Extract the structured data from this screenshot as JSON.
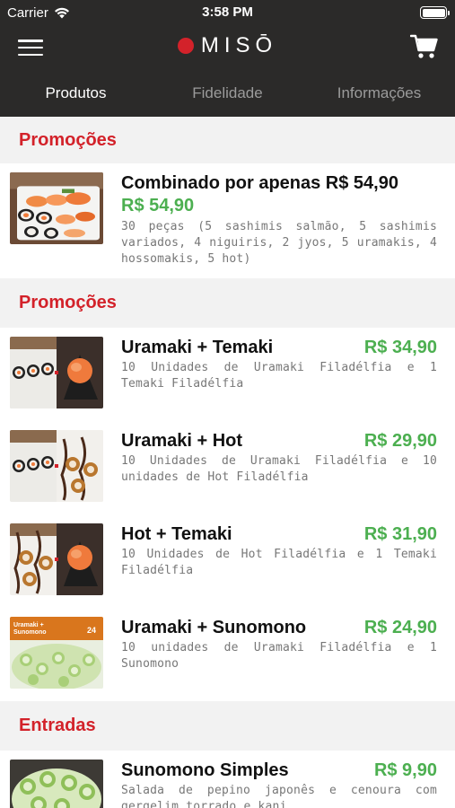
{
  "status_bar": {
    "carrier": "Carrier",
    "time": "3:58 PM"
  },
  "header": {
    "logo_text": "MISŌ",
    "brand_color": "#d3222a",
    "menu_icon": "hamburger-menu-icon",
    "cart_icon": "shopping-cart-icon"
  },
  "tabs": [
    {
      "label": "Produtos",
      "active": true
    },
    {
      "label": "Fidelidade",
      "active": false
    },
    {
      "label": "Informações",
      "active": false
    }
  ],
  "sections": [
    {
      "title": "Promoções",
      "items": [
        {
          "name": "Combinado por apenas R$ 54,90",
          "price": "R$ 54,90",
          "description": "30 peças (5 sashimis salmão, 5 sashimis variados, 4 niguiris, 2 jyos, 5 uramakis, 4 hossomakis, 5 hot)"
        }
      ]
    },
    {
      "title": "Promoções",
      "items": [
        {
          "name": "Uramaki + Temaki",
          "price": "R$ 34,90",
          "description": "10 Unidades de Uramaki Filadélfia e 1 Temaki Filadélfia"
        },
        {
          "name": "Uramaki + Hot",
          "price": "R$ 29,90",
          "description": "10 Unidades de Uramaki Filadélfia e 10 unidades de Hot Filadélfia"
        },
        {
          "name": "Hot + Temaki",
          "price": "R$ 31,90",
          "description": "10 Unidades de Hot Filadélfia e 1 Temaki Filadélfia"
        },
        {
          "name": "Uramaki + Sunomono",
          "price": "R$ 24,90",
          "description": "10 unidades de Uramaki Filadélfia e 1 Sunomono",
          "thumb_banner": "Uramaki + Sunomono",
          "thumb_banner_price": "24"
        }
      ]
    },
    {
      "title": "Entradas",
      "items": [
        {
          "name": "Sunomono Simples",
          "price": "R$ 9,90",
          "description": "Salada de pepino japonês e cenoura com gergelim torrado e kani"
        }
      ]
    }
  ],
  "colors": {
    "header_bg": "#2b2a29",
    "section_title": "#d3222a",
    "price": "#4caf50",
    "section_bg": "#f2f2f2"
  }
}
